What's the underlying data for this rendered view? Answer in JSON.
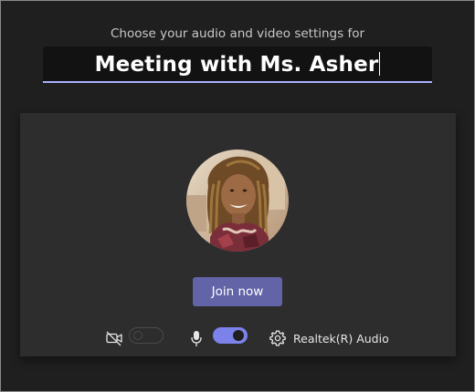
{
  "header": {
    "subtitle": "Choose your audio and video settings for",
    "meeting_title": "Meeting with Ms. Asher"
  },
  "preview": {
    "avatar_icon": "user-avatar-photo"
  },
  "actions": {
    "join_label": "Join now"
  },
  "controls": {
    "camera": {
      "icon": "camera-off-icon",
      "enabled": false
    },
    "microphone": {
      "icon": "microphone-icon",
      "enabled": true
    },
    "audio_device": {
      "icon": "gear-icon",
      "label": "Realtek(R) Audio"
    }
  },
  "colors": {
    "accent": "#6264a7",
    "toggle_on": "#7b83eb",
    "underline": "#aab0ff",
    "background": "#1f1f1f",
    "panel": "#2d2d2d"
  }
}
